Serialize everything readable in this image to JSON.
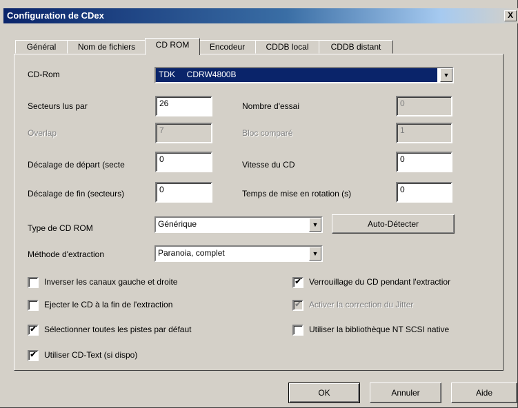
{
  "window": {
    "title": "Configuration de CDex",
    "close_label": "X"
  },
  "tabs": [
    {
      "label": "Général"
    },
    {
      "label": "Nom de fichiers"
    },
    {
      "label": "CD ROM"
    },
    {
      "label": "Encodeur"
    },
    {
      "label": "CDDB local"
    },
    {
      "label": "CDDB distant"
    }
  ],
  "cdrom": {
    "label": "CD-Rom",
    "value": "TDK     CDRW4800B"
  },
  "fields": {
    "sectors_label": "Secteurs lus par",
    "sectors_value": "26",
    "tries_label": "Nombre d'essai",
    "tries_value": "0",
    "overlap_label": "Overlap",
    "overlap_value": "7",
    "block_label": "Bloc comparé",
    "block_value": "1",
    "start_label": "Décalage de départ (secte",
    "start_value": "0",
    "speed_label": "Vitesse du CD",
    "speed_value": "0",
    "end_label": "Décalage de fin (secteurs)",
    "end_value": "0",
    "spin_label": "Temps de mise en rotation (s)",
    "spin_value": "0"
  },
  "type_cd": {
    "label": "Type de CD ROM",
    "value": "Générique",
    "autodetect": "Auto-Détecter"
  },
  "method": {
    "label": "Méthode d'extraction",
    "value": "Paranoia, complet"
  },
  "checks": {
    "swap": {
      "label": "Inverser les canaux gauche et droite",
      "mark": ""
    },
    "eject": {
      "label": "Ejecter le CD à la fin de l'extraction",
      "mark": ""
    },
    "select_all": {
      "label": "Sélectionner toutes les pistes par défaut",
      "mark": "✔"
    },
    "cdtext": {
      "label": "Utiliser CD-Text (si dispo)",
      "mark": "✔"
    },
    "lock": {
      "label": "Verrouillage du CD pendant l'extractior",
      "mark": "✔"
    },
    "jitter": {
      "label": "Activer la correction du Jitter",
      "mark": "✔"
    },
    "ntscsi": {
      "label": "Utiliser la bibliothèque NT SCSI native",
      "mark": ""
    }
  },
  "buttons": {
    "ok": "OK",
    "cancel": "Annuler",
    "help": "Aide"
  }
}
